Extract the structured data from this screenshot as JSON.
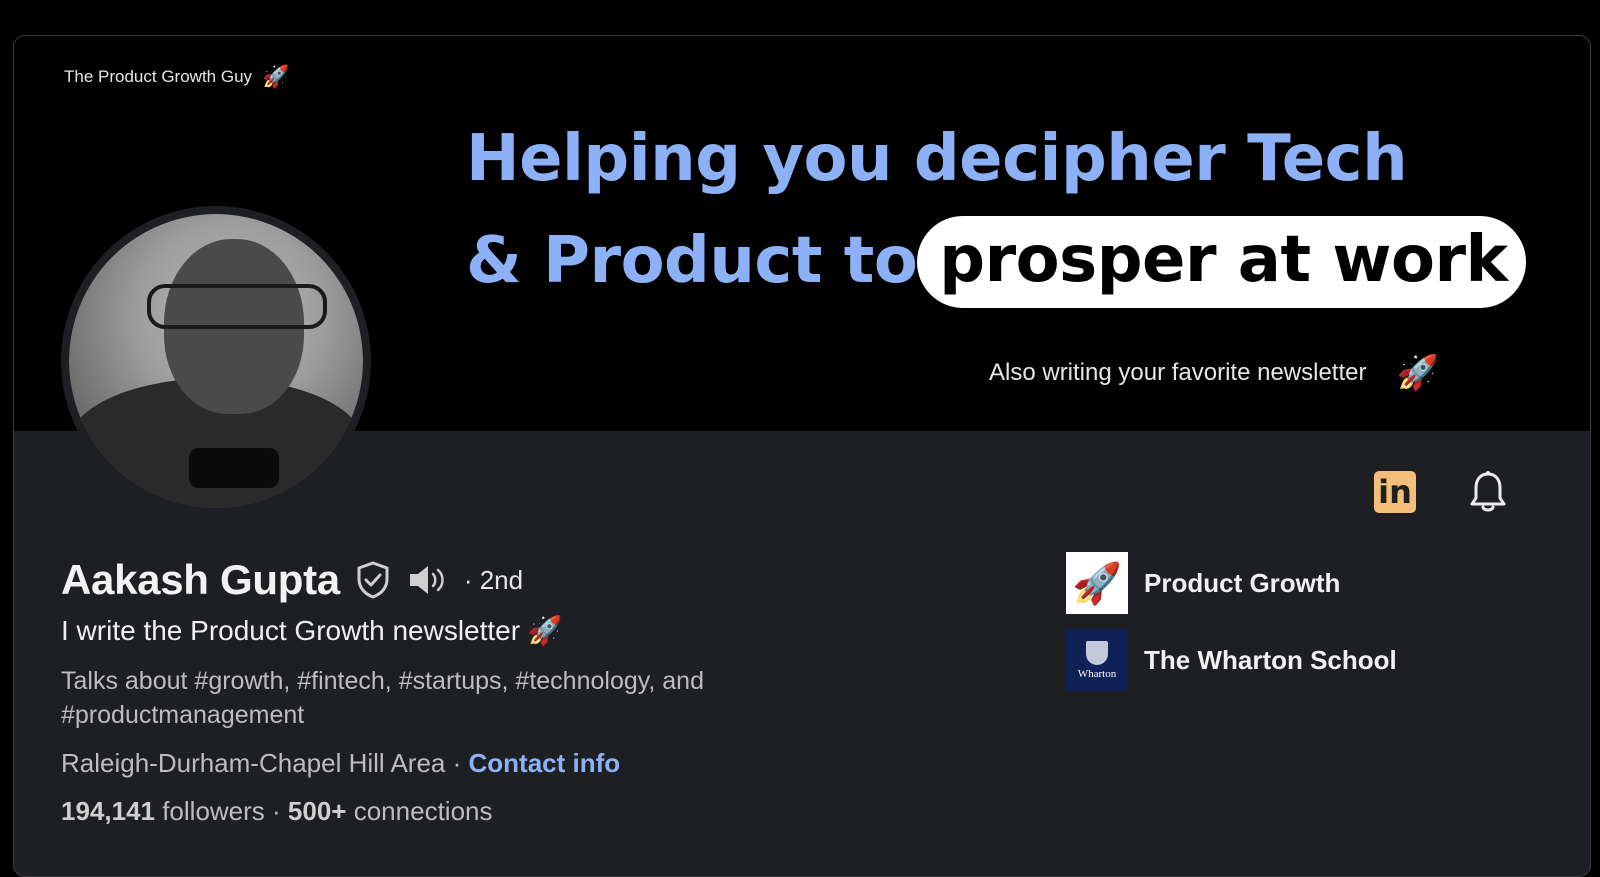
{
  "banner": {
    "brand": "The Product Growth Guy",
    "headline_line1": "Helping you decipher Tech",
    "headline_line2_prefix": "& Product to",
    "headline_highlight": "prosper at work",
    "tagline": "Also writing your favorite newsletter",
    "rocket_glyph": "🚀"
  },
  "profile": {
    "name": "Aakash Gupta",
    "degree": "· 2nd",
    "headline": "I write the Product Growth newsletter 🚀",
    "about": "Talks about #growth, #fintech, #startups, #technology, and #productmanagement",
    "location": "Raleigh-Durham-Chapel Hill Area",
    "location_sep": " · ",
    "contact_label": "Contact info",
    "followers_count": "194,141",
    "followers_label": " followers",
    "stats_sep": "  · ",
    "connections_count": "500+",
    "connections_label": " connections"
  },
  "orgs": [
    {
      "name": "Product Growth",
      "icon": "rocket-icon"
    },
    {
      "name": "The Wharton School",
      "logo_text": "Wharton",
      "icon": "wharton-logo"
    }
  ],
  "icons": {
    "linkedin": "in",
    "bell": "bell-icon",
    "verified": "shield-check-icon",
    "audio": "speaker-icon"
  },
  "colors": {
    "accent_blue": "#8db1f7",
    "linkedin_badge": "#f2be78",
    "card_bg": "#1d1f23"
  }
}
